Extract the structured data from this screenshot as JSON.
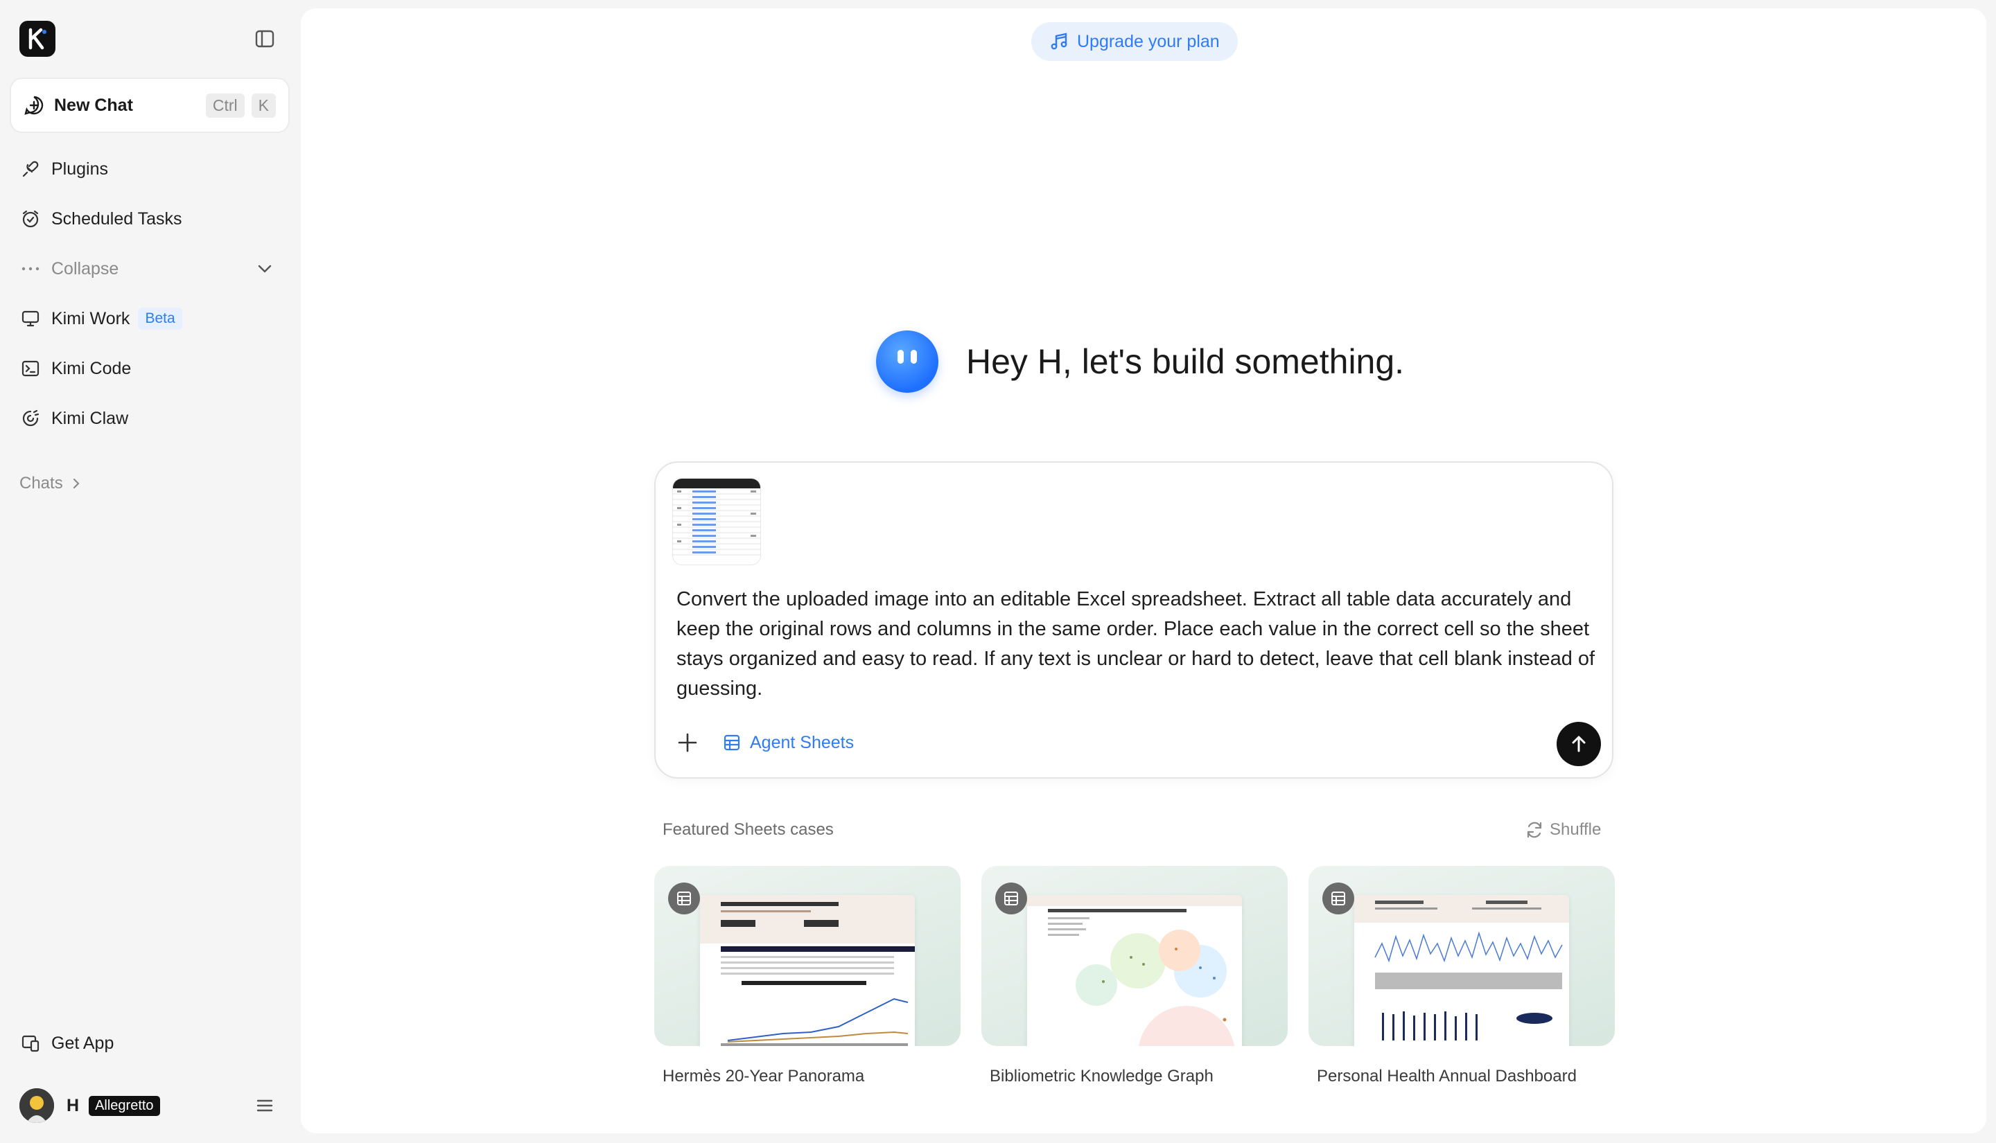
{
  "sidebar": {
    "new_chat": {
      "label": "New Chat",
      "shortcut_mod": "Ctrl",
      "shortcut_key": "K"
    },
    "items": [
      {
        "label": "Plugins"
      },
      {
        "label": "Scheduled Tasks"
      },
      {
        "label": "Collapse"
      },
      {
        "label": "Kimi Work",
        "badge": "Beta"
      },
      {
        "label": "Kimi Code"
      },
      {
        "label": "Kimi Claw"
      }
    ],
    "chats_label": "Chats",
    "get_app": "Get App",
    "user": {
      "name": "H",
      "tier": "Allegretto"
    }
  },
  "main": {
    "upgrade_label": "Upgrade your plan",
    "greeting": "Hey H, let's build something.",
    "composer": {
      "prompt": "Convert the uploaded image into an editable Excel spreadsheet. Extract all table data accurately and keep the original rows and columns in the same order. Place each value in the correct cell so the sheet stays organized and easy to read. If any text is unclear or hard to detect, leave that cell blank instead of guessing.",
      "tool_label": "Agent Sheets"
    },
    "featured": {
      "title": "Featured Sheets cases",
      "shuffle_label": "Shuffle",
      "cards": [
        {
          "label": "Hermès 20-Year Panorama"
        },
        {
          "label": "Bibliometric Knowledge Graph"
        },
        {
          "label": "Personal Health Annual Dashboard"
        }
      ]
    }
  },
  "colors": {
    "accent": "#2f7bf5",
    "dark": "#111111",
    "sidebar_bg": "#f5f5f5"
  }
}
